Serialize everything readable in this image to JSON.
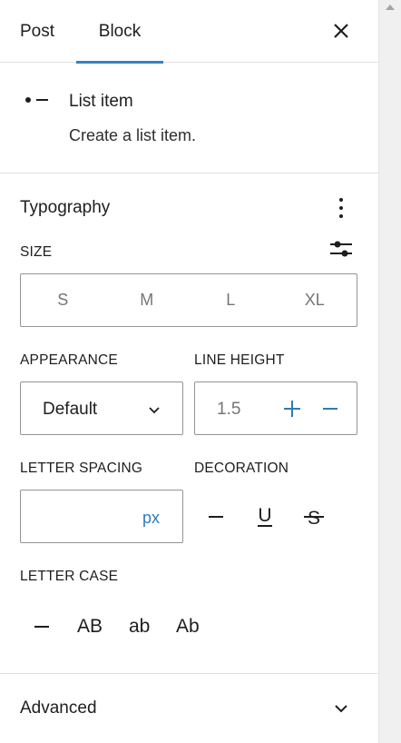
{
  "tabs": {
    "post": "Post",
    "block": "Block",
    "active": "Block"
  },
  "block": {
    "title": "List item",
    "description": "Create a list item.",
    "icon": "list-item-icon"
  },
  "typography": {
    "title": "Typography",
    "size": {
      "label": "SIZE",
      "options": [
        "S",
        "M",
        "L",
        "XL"
      ]
    },
    "appearance": {
      "label": "APPEARANCE",
      "value": "Default"
    },
    "line_height": {
      "label": "LINE HEIGHT",
      "placeholder": "1.5"
    },
    "letter_spacing": {
      "label": "LETTER SPACING",
      "unit": "px",
      "value": ""
    },
    "decoration": {
      "label": "DECORATION",
      "options": [
        "none",
        "underline",
        "strikethrough"
      ],
      "underline_glyph": "U",
      "strike_glyph": "S"
    },
    "letter_case": {
      "label": "LETTER CASE",
      "options": [
        "none",
        "AB",
        "ab",
        "Ab"
      ]
    }
  },
  "advanced": {
    "title": "Advanced"
  },
  "colors": {
    "accent": "#3582c4",
    "text": "#1e1e1e",
    "muted": "#757575",
    "border": "#949494",
    "divider": "#e0e0e0"
  }
}
